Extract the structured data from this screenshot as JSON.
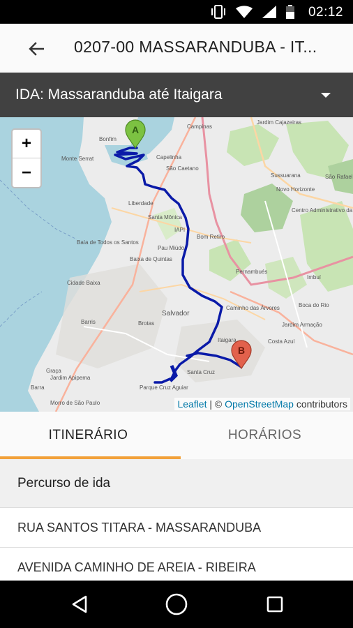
{
  "status_bar": {
    "time": "02:12",
    "icons": [
      "vibrate-icon",
      "wifi-icon",
      "signal-icon",
      "battery-icon"
    ]
  },
  "app_bar": {
    "title": "0207-00 MASSARANDUBA - IT..."
  },
  "direction_spinner": {
    "selected": "IDA: Massaranduba até Itaigara"
  },
  "map": {
    "zoom_in": "+",
    "zoom_out": "−",
    "marker_start": "A",
    "marker_end": "B",
    "attribution": {
      "leaflet": "Leaflet",
      "separator": " | © ",
      "osm": "OpenStreetMap",
      "contributors": " contributors"
    },
    "place_labels": [
      "Bonfim",
      "Monte Serrat",
      "Campinas",
      "Jardim Cajazeiras",
      "Capelinha",
      "São Caetano",
      "Liberdade",
      "Santa Mônica",
      "IAPI",
      "Baixa de Quintas",
      "Pau Miúdo",
      "Bom Retiro",
      "Pernambués",
      "Salvador",
      "Brotas",
      "Caminho das Árvores",
      "Itaigara",
      "Costa Azul",
      "Boca do Rio",
      "Jardim Armação",
      "Imbuí",
      "Novo Horizonte",
      "Sussuarana",
      "São Rafael",
      "Cidade Baixa",
      "Barris",
      "Graça",
      "Barra",
      "Jardim Apipema",
      "Santa Cruz",
      "Parque Cruz Aguiar",
      "Morro de São Paulo",
      "Baía de Todos os Santos",
      "Centro Administrativo da Bahia"
    ],
    "accent_route": "#0a1aa8",
    "marker_color_start": "#7cc242",
    "marker_color_end": "#e2614c"
  },
  "tabs": [
    {
      "label": "ITINERÁRIO",
      "active": true
    },
    {
      "label": "HORÁRIOS",
      "active": false
    }
  ],
  "itinerary": {
    "header": "Percurso de ida",
    "stops": [
      "RUA SANTOS TITARA - MASSARANDUBA",
      "AVENIDA CAMINHO DE AREIA - RIBEIRA"
    ]
  },
  "colors": {
    "tab_indicator": "#f2a13a",
    "spinner_bg": "#414141"
  }
}
